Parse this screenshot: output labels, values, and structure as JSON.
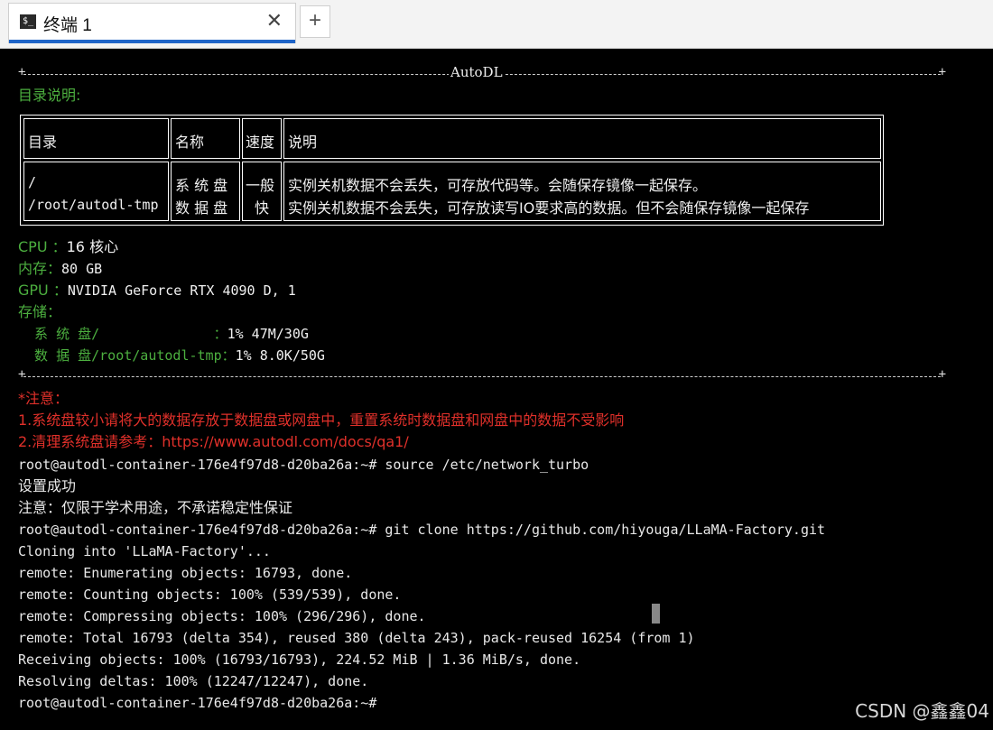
{
  "tab": {
    "icon": "$_",
    "title": "终端 1",
    "close": "✕",
    "new": "+"
  },
  "header": {
    "label": "AutoDL",
    "section_title": "目录说明:"
  },
  "table": {
    "headers": [
      "目录",
      "名称",
      "速度",
      "说明"
    ],
    "rows": [
      {
        "dir": "/",
        "name": "系 统 盘",
        "speed": "一般",
        "desc": "实例关机数据不会丢失，可存放代码等。会随保存镜像一起保存。"
      },
      {
        "dir": "/root/autodl-tmp",
        "name": "数 据 盘",
        "speed": "快",
        "desc": "实例关机数据不会丢失，可存放读写IO要求高的数据。但不会随保存镜像一起保存"
      }
    ]
  },
  "specs": {
    "cpu_label": "CPU ：",
    "cpu_value": "16 核心",
    "mem_label": "内存：",
    "mem_value": "80 GB",
    "gpu_label": "GPU ：",
    "gpu_value": "NVIDIA GeForce RTX 4090 D, 1",
    "storage_label": "存储：",
    "sys_disk_label": "  系 统 盘/              ：",
    "sys_disk_value": "1% 47M/30G",
    "data_disk_label": "  数 据 盘/root/autodl-tmp：",
    "data_disk_value": "1% 8.0K/50G"
  },
  "notes": {
    "title": "*注意：",
    "line1": "1.系统盘较小请将大的数据存放于数据盘或网盘中，重置系统时数据盘和网盘中的数据不受影响",
    "line2": "2.清理系统盘请参考：https://www.autodl.com/docs/qa1/"
  },
  "output": [
    "root@autodl-container-176e4f97d8-d20ba26a:~# source /etc/network_turbo",
    "设置成功",
    "注意：仅限于学术用途，不承诺稳定性保证",
    "root@autodl-container-176e4f97d8-d20ba26a:~# git clone https://github.com/hiyouga/LLaMA-Factory.git",
    "Cloning into 'LLaMA-Factory'...",
    "remote: Enumerating objects: 16793, done.",
    "remote: Counting objects: 100% (539/539), done.",
    "remote: Compressing objects: 100% (296/296), done.",
    "remote: Total 16793 (delta 354), reused 380 (delta 243), pack-reused 16254 (from 1)",
    "Receiving objects: 100% (16793/16793), 224.52 MiB | 1.36 MiB/s, done.",
    "Resolving deltas: 100% (12247/12247), done.",
    "root@autodl-container-176e4f97d8-d20ba26a:~#"
  ],
  "watermark": "CSDN @鑫鑫04"
}
